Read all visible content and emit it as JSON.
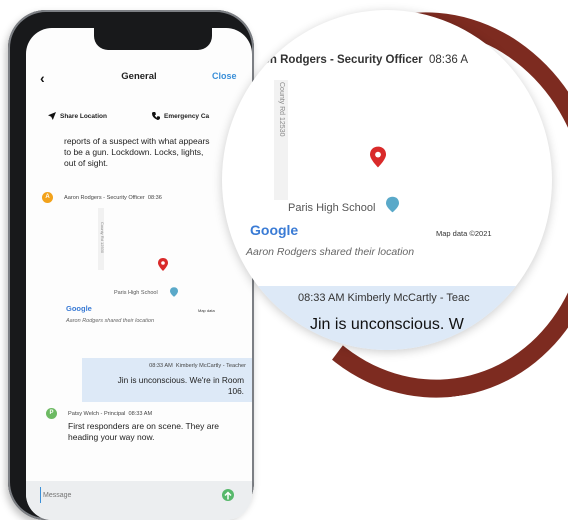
{
  "header": {
    "back_icon": "‹",
    "title": "General",
    "close_label": "Close"
  },
  "actions": {
    "share_location": "Share Location",
    "emergency_call": "Emergency Ca"
  },
  "messages": {
    "first_text": "reports of a suspect with what appears to be a gun. Lockdown. Locks, lights, out of sight.",
    "aaron_sender": "Aaron Rodgers - Security Officer",
    "aaron_time": "08:36",
    "map_place": "Paris High School",
    "map_road": "County Rd 12530",
    "map_brand": "Google",
    "map_data": "Map data",
    "map_data_big": "Map data ©2021",
    "location_caption": "Aaron Rodgers shared their location",
    "kimberly_time": "08:33 AM",
    "kimberly_sender": "Kimberly McCartly - Teacher",
    "kimberly_text": "Jin is unconscious. We're in Room 106.",
    "patsy_avatar": "P",
    "aaron_avatar": "A",
    "patsy_sender": "Patsy Welch - Principal",
    "patsy_time": "08:33 AM",
    "patsy_text": "First responders are on scene. They are heading your way now."
  },
  "input": {
    "placeholder": "Message"
  },
  "zoom": {
    "sender_line": "aron Rodgers - Security Officer",
    "time": "08:36 A",
    "road": "County Rd 12530",
    "place": "Paris High School",
    "brand": "Google",
    "map_data": "Map data ©2021",
    "caption": "Aaron Rodgers shared their location",
    "bubble_meta": "08:33 AM  Kimberly McCartly - Teac",
    "bubble_text": "Jin is unconscious. W"
  },
  "colors": {
    "accent": "#3a8fd8",
    "pin": "#d92a2a",
    "ring": "#7d2b20",
    "bubble": "#dde9f7"
  }
}
